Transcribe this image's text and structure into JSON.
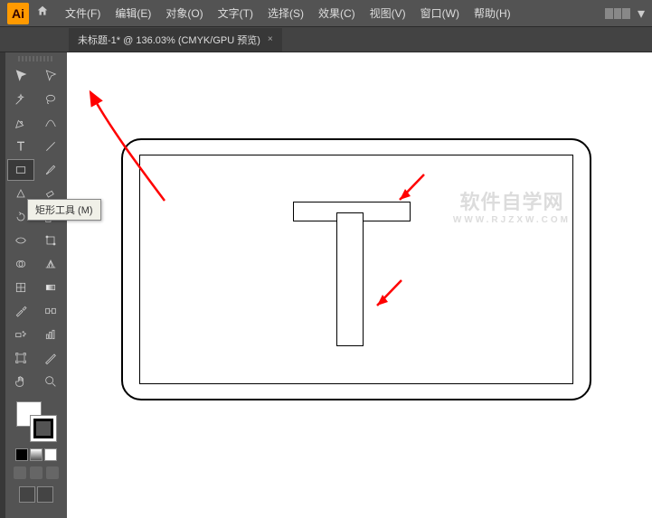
{
  "app": {
    "logo": "Ai"
  },
  "menu": {
    "items": [
      "文件(F)",
      "编辑(E)",
      "对象(O)",
      "文字(T)",
      "选择(S)",
      "效果(C)",
      "视图(V)",
      "窗口(W)",
      "帮助(H)"
    ]
  },
  "tabs": {
    "active": {
      "title": "未标题-1* @ 136.03% (CMYK/GPU 预览)",
      "close": "×"
    }
  },
  "tooltip": {
    "text": "矩形工具 (M)"
  },
  "watermark": {
    "main": "软件自学网",
    "sub": "WWW.RJZXW.COM"
  },
  "tools": {
    "names": [
      "selection-tool",
      "direct-selection-tool",
      "magic-wand-tool",
      "lasso-tool",
      "pen-tool",
      "curvature-tool",
      "type-tool",
      "line-segment-tool",
      "rectangle-tool",
      "paintbrush-tool",
      "shaper-tool",
      "eraser-tool",
      "rotate-tool",
      "scale-tool",
      "width-tool",
      "free-transform-tool",
      "shape-builder-tool",
      "perspective-grid-tool",
      "mesh-tool",
      "gradient-tool",
      "eyedropper-tool",
      "blend-tool",
      "symbol-sprayer-tool",
      "column-graph-tool",
      "artboard-tool",
      "slice-tool",
      "hand-tool",
      "zoom-tool"
    ]
  },
  "colors": {
    "fill": "#ffffff",
    "stroke": "#000000"
  }
}
